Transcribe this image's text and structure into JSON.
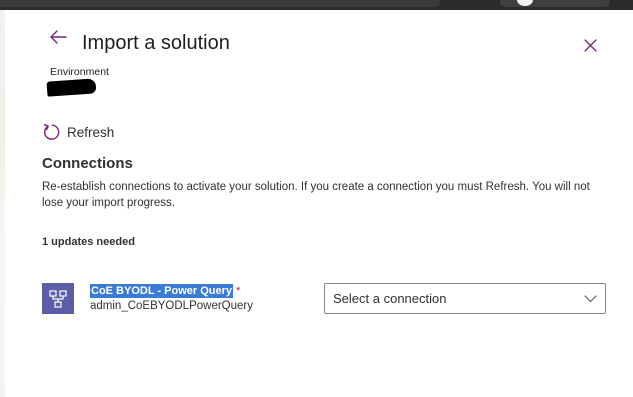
{
  "panel": {
    "title": "Import a solution",
    "environment_label": "Environment",
    "refresh_label": "Refresh"
  },
  "connections": {
    "heading": "Connections",
    "description": "Re-establish connections to activate your solution. If you create a connection you must Refresh. You will not lose your import progress.",
    "updates_needed": "1 updates needed",
    "items": [
      {
        "name": "CoE BYODL - Power Query",
        "required_mark": "*",
        "reference": "admin_CoEBYODLPowerQuery",
        "select_placeholder": "Select a connection",
        "icon": "power-query-connector-icon"
      }
    ]
  },
  "icons": {
    "back": "back-arrow-icon",
    "close": "close-icon",
    "refresh": "refresh-icon",
    "dropdown": "chevron-down-icon"
  },
  "colors": {
    "accent": "#742774",
    "connector_icon_bg": "#5b5ea6",
    "selection_highlight": "#3a7bd5",
    "required": "#a4262c"
  }
}
